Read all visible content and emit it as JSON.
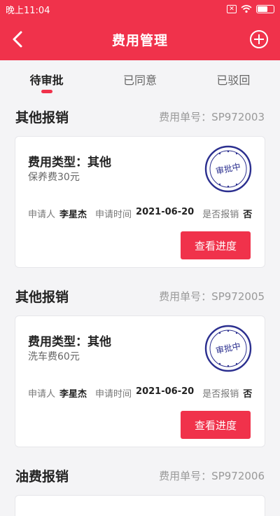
{
  "status_bar": {
    "time": "晚上11:04",
    "battery": "",
    "close_glyph": "✕"
  },
  "header": {
    "title": "费用管理"
  },
  "tabs": [
    {
      "label": "待审批",
      "active": true
    },
    {
      "label": "已同意",
      "active": false
    },
    {
      "label": "已驳回",
      "active": false
    }
  ],
  "labels": {
    "type_prefix": "费用类型：",
    "applicant": "申请人",
    "apply_time": "申请时间",
    "reimbursed": "是否报销",
    "progress_button": "查看进度",
    "no_prefix": "费用单号："
  },
  "expenses": [
    {
      "section_title": "其他报销",
      "number": "SP972003",
      "type": "其他",
      "desc": "保养费30元",
      "applicant": "李星杰",
      "date": "2021-06-20",
      "reimbursed": "否",
      "stamp": "审批中"
    },
    {
      "section_title": "其他报销",
      "number": "SP972005",
      "type": "其他",
      "desc": "洗车费60元",
      "applicant": "李星杰",
      "date": "2021-06-20",
      "reimbursed": "否",
      "stamp": "审批中"
    },
    {
      "section_title": "油费报销",
      "number": "SP972006"
    }
  ],
  "colors": {
    "primary": "#f0324b",
    "stamp": "#2b2f8f"
  }
}
